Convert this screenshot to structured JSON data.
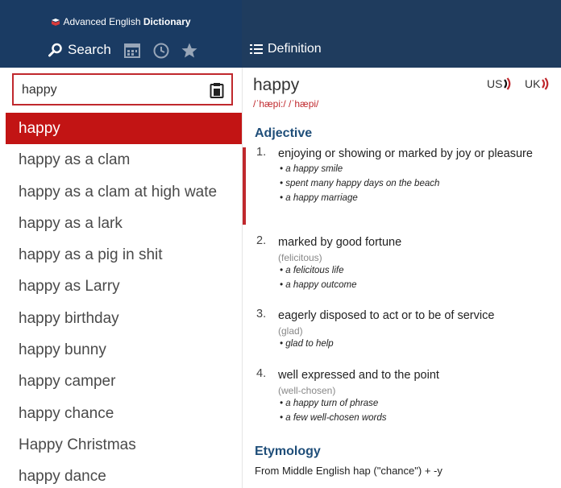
{
  "app": {
    "title_prefix": "Advanced English ",
    "title_bold": "Dictionary"
  },
  "nav": {
    "search_label": "Search",
    "definition_label": "Definition"
  },
  "search": {
    "value": "happy"
  },
  "word_list": [
    "happy",
    "happy as a clam",
    "happy as a clam at high wate",
    "happy as a lark",
    "happy as a pig in shit",
    "happy as Larry",
    "happy birthday",
    "happy bunny",
    "happy camper",
    "happy chance",
    "Happy Christmas",
    "happy dance"
  ],
  "entry": {
    "headword": "happy",
    "pronunciation": "/ˈhæpi:/ /ˈhæpi/",
    "audio_us": "US",
    "audio_uk": "UK",
    "pos": "Adjective",
    "senses": [
      {
        "num": "1.",
        "def": "enjoying or showing or marked by joy or pleasure",
        "syn": "",
        "examples": [
          "a happy smile",
          "spent many happy days on the beach",
          "a happy marriage"
        ]
      },
      {
        "num": "2.",
        "def": "marked by good fortune",
        "syn": "(felicitous)",
        "examples": [
          "a felicitous life",
          "a happy outcome"
        ]
      },
      {
        "num": "3.",
        "def": "eagerly disposed to act or to be of service",
        "syn": "(glad)",
        "examples": [
          "glad to help"
        ]
      },
      {
        "num": "4.",
        "def": "well expressed and to the point",
        "syn": "(well-chosen)",
        "examples": [
          "a happy turn of phrase",
          "a few well-chosen words"
        ]
      }
    ],
    "etymology_heading": "Etymology",
    "etymology_text": "From Middle English hap (\"chance\") + -y"
  },
  "colors": {
    "header": "#1a3b63",
    "accent": "#c0282d",
    "selected": "#c21414",
    "heading": "#1f4e79"
  },
  "icons": [
    "dictionary-logo-icon",
    "search-icon",
    "calendar-icon",
    "history-icon",
    "star-icon",
    "list-icon",
    "clipboard-icon",
    "speaker-icon"
  ]
}
